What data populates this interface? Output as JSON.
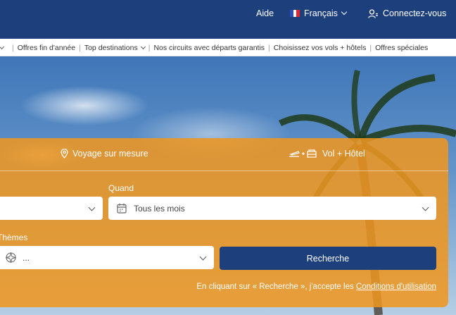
{
  "header": {
    "help": "Aide",
    "language": "Français",
    "login": "Connectez-vous",
    "colors": {
      "background": "#1d3f7c"
    }
  },
  "nav": {
    "items": [
      "Offres fin d'année",
      "Top destinations",
      "Nos circuits avec départs garantis",
      "Choisissez vos vols + hôtels",
      "Offres spéciales"
    ]
  },
  "search": {
    "tabs": {
      "custom_trip": "Voyage sur mesure",
      "flight_hotel": "Vol + Hôtel"
    },
    "when": {
      "label": "Quand",
      "value": "Tous les mois"
    },
    "themes": {
      "label": "Thèmes",
      "value": "..."
    },
    "button": "Recherche",
    "legal": {
      "text": "En cliquant sur « Recherche », j'accepte les ",
      "link": "Conditions d'utilisation"
    },
    "colors": {
      "panel": "#f0961e",
      "button": "#1d3f7c"
    }
  }
}
